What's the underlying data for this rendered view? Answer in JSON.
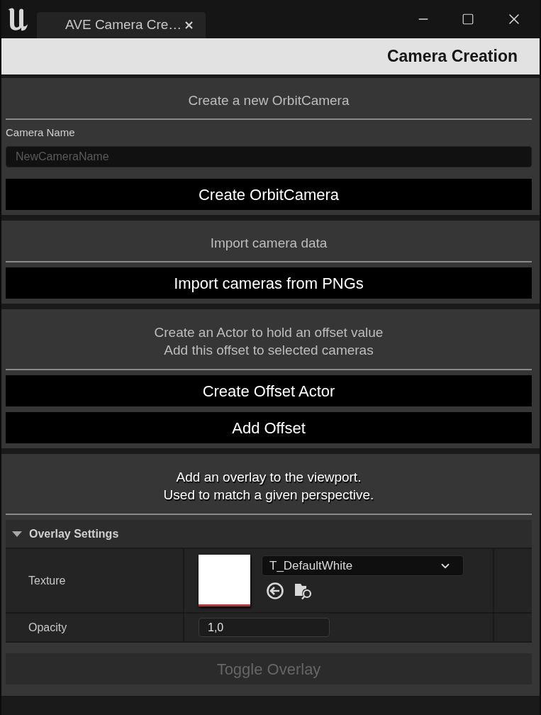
{
  "window": {
    "tabs": [
      {
        "label": "AVE Camera Cre…",
        "selected": true
      }
    ]
  },
  "header": {
    "title": "Camera Creation"
  },
  "sections": [
    {
      "heading": [
        "Create a new OrbitCamera"
      ],
      "emphasized": false,
      "field": {
        "label": "Camera Name",
        "placeholder": "NewCameraName"
      },
      "buttons": [
        {
          "label": "Create OrbitCamera",
          "disabled": false
        }
      ]
    },
    {
      "heading": [
        "Import camera data"
      ],
      "emphasized": false,
      "buttons": [
        {
          "label": "Import cameras from PNGs",
          "disabled": false
        }
      ]
    },
    {
      "heading": [
        "Create an Actor to hold an offset value",
        "Add this offset to selected cameras"
      ],
      "emphasized": false,
      "buttons": [
        {
          "label": "Create Offset Actor",
          "disabled": false
        },
        {
          "label": "Add Offset",
          "disabled": false
        }
      ]
    },
    {
      "heading": [
        "Add an overlay to the viewport.",
        "Used to match a given perspective."
      ],
      "emphasized": true,
      "details": {
        "category": {
          "label": "Overlay Settings",
          "expanded": true
        },
        "properties": [
          {
            "kind": "texture",
            "label": "Texture",
            "value": "T_DefaultWhite"
          },
          {
            "kind": "number",
            "label": "Opacity",
            "value": "1,0"
          }
        ]
      },
      "buttons": [
        {
          "label": "Toggle Overlay",
          "disabled": true
        }
      ]
    }
  ]
}
